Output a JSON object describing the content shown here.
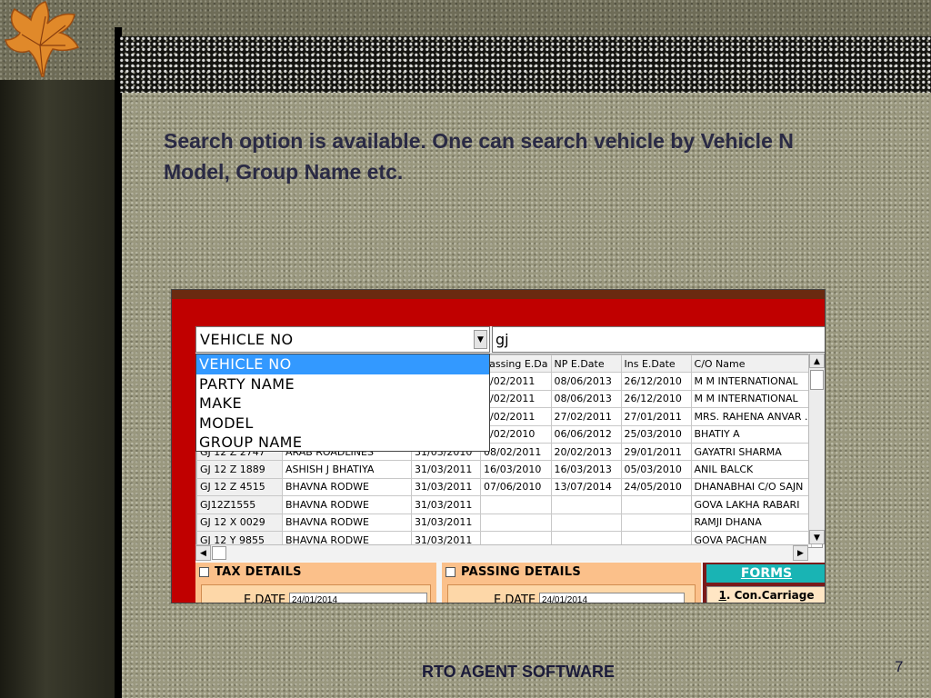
{
  "slide": {
    "text_lines": [
      "Search option is available. One can search vehicle by Vehicle N",
      "Model, Group Name etc."
    ],
    "footer": "RTO  AGENT SOFTWARE",
    "page_number": "7"
  },
  "colors": {
    "app_red": "#c00000",
    "selection_blue": "#3399ff",
    "panel_orange": "#fbc08a",
    "forms_teal": "#19b4b4"
  },
  "search": {
    "field_selected": "VEHICLE NO",
    "query_value": "gj",
    "options": [
      "VEHICLE NO",
      "PARTY NAME",
      "MAKE",
      "MODEL",
      "GROUP NAME"
    ]
  },
  "grid": {
    "headers": [
      "",
      "",
      "",
      "Passing E.Da",
      "NP E.Date",
      "Ins E.Date",
      "C/O Name"
    ],
    "rows": [
      [
        "",
        "",
        "",
        "8/02/2011",
        "08/06/2013",
        "26/12/2010",
        "M M INTERNATIONAL"
      ],
      [
        "",
        "",
        "",
        "8/02/2011",
        "08/06/2013",
        "26/12/2010",
        "M M INTERNATIONAL"
      ],
      [
        "",
        "",
        "",
        "8/02/2011",
        "27/02/2011",
        "27/01/2011",
        "MRS. RAHENA ANVAR ."
      ],
      [
        "",
        "",
        "",
        "8/02/2010",
        "06/06/2012",
        "25/03/2010",
        "BHATIY A"
      ],
      [
        "GJ 12 Z 2747",
        "ARAB ROADLINES",
        "31/03/2010",
        "08/02/2011",
        "20/02/2013",
        "29/01/2011",
        "GAYATRI SHARMA"
      ],
      [
        "GJ 12 Z 1889",
        "ASHISH J BHATIYA",
        "31/03/2011",
        "16/03/2010",
        "16/03/2013",
        "05/03/2010",
        "ANIL BALCK"
      ],
      [
        "GJ 12 Z 4515",
        "BHAVNA RODWE",
        "31/03/2011",
        "07/06/2010",
        "13/07/2014",
        "24/05/2010",
        "DHANABHAI C/O SAJN"
      ],
      [
        "GJ12Z1555",
        "BHAVNA RODWE",
        "31/03/2011",
        "",
        "",
        "",
        "GOVA LAKHA RABARI"
      ],
      [
        "GJ 12 X 0029",
        "BHAVNA RODWE",
        "31/03/2011",
        "",
        "",
        "",
        "RAMJI DHANA"
      ],
      [
        "GJ 12 Y 9855",
        "BHAVNA RODWE",
        "31/03/2011",
        "",
        "",
        "",
        "GOVA PACHAN"
      ]
    ]
  },
  "tax_panel": {
    "title": "TAX DETAILS",
    "edate_label": "E.DATE",
    "edate_value": "24/01/2014"
  },
  "passing_panel": {
    "title": "PASSING  DETAILS",
    "edate_label": "E.DATE",
    "edate_value": "24/01/2014"
  },
  "forms": {
    "heading": "FORMS",
    "button_number": "1",
    "button_label": ". Con.Carriage"
  },
  "icons": [
    "leaf-icon",
    "dropdown-arrow-icon",
    "scroll-up-icon",
    "scroll-down-icon",
    "scroll-left-icon",
    "scroll-right-icon"
  ]
}
